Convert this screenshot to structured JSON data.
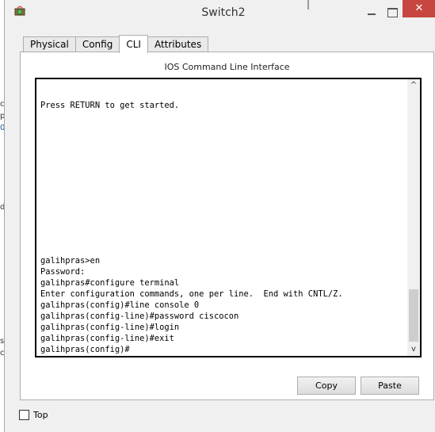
{
  "window": {
    "title": "Switch2",
    "close_glyph": "✕",
    "icons": {
      "app": "cisco-device-icon",
      "minimize": "minimize-icon",
      "maximize": "maximize-icon",
      "close": "close-icon"
    }
  },
  "tabs": [
    {
      "label": "Physical",
      "active": false
    },
    {
      "label": "Config",
      "active": false
    },
    {
      "label": "CLI",
      "active": true
    },
    {
      "label": "Attributes",
      "active": false
    }
  ],
  "cli": {
    "heading": "IOS Command Line Interface",
    "lines": [
      "Press RETURN to get started.",
      "galihpras>en",
      "Password:",
      "galihpras#configure terminal",
      "Enter configuration commands, one per line.  End with CNTL/Z.",
      "galihpras(config)#line console 0",
      "galihpras(config-line)#password ciscocon",
      "galihpras(config-line)#login",
      "galihpras(config-line)#exit",
      "galihpras(config)#"
    ],
    "scroll_up_glyph": "^",
    "scroll_down_glyph": "v"
  },
  "buttons": {
    "copy": "Copy",
    "paste": "Paste"
  },
  "top_checkbox": {
    "label": "Top",
    "checked": false
  },
  "background_fragments": [
    "c",
    "p",
    "0",
    "d",
    "s",
    "c"
  ]
}
